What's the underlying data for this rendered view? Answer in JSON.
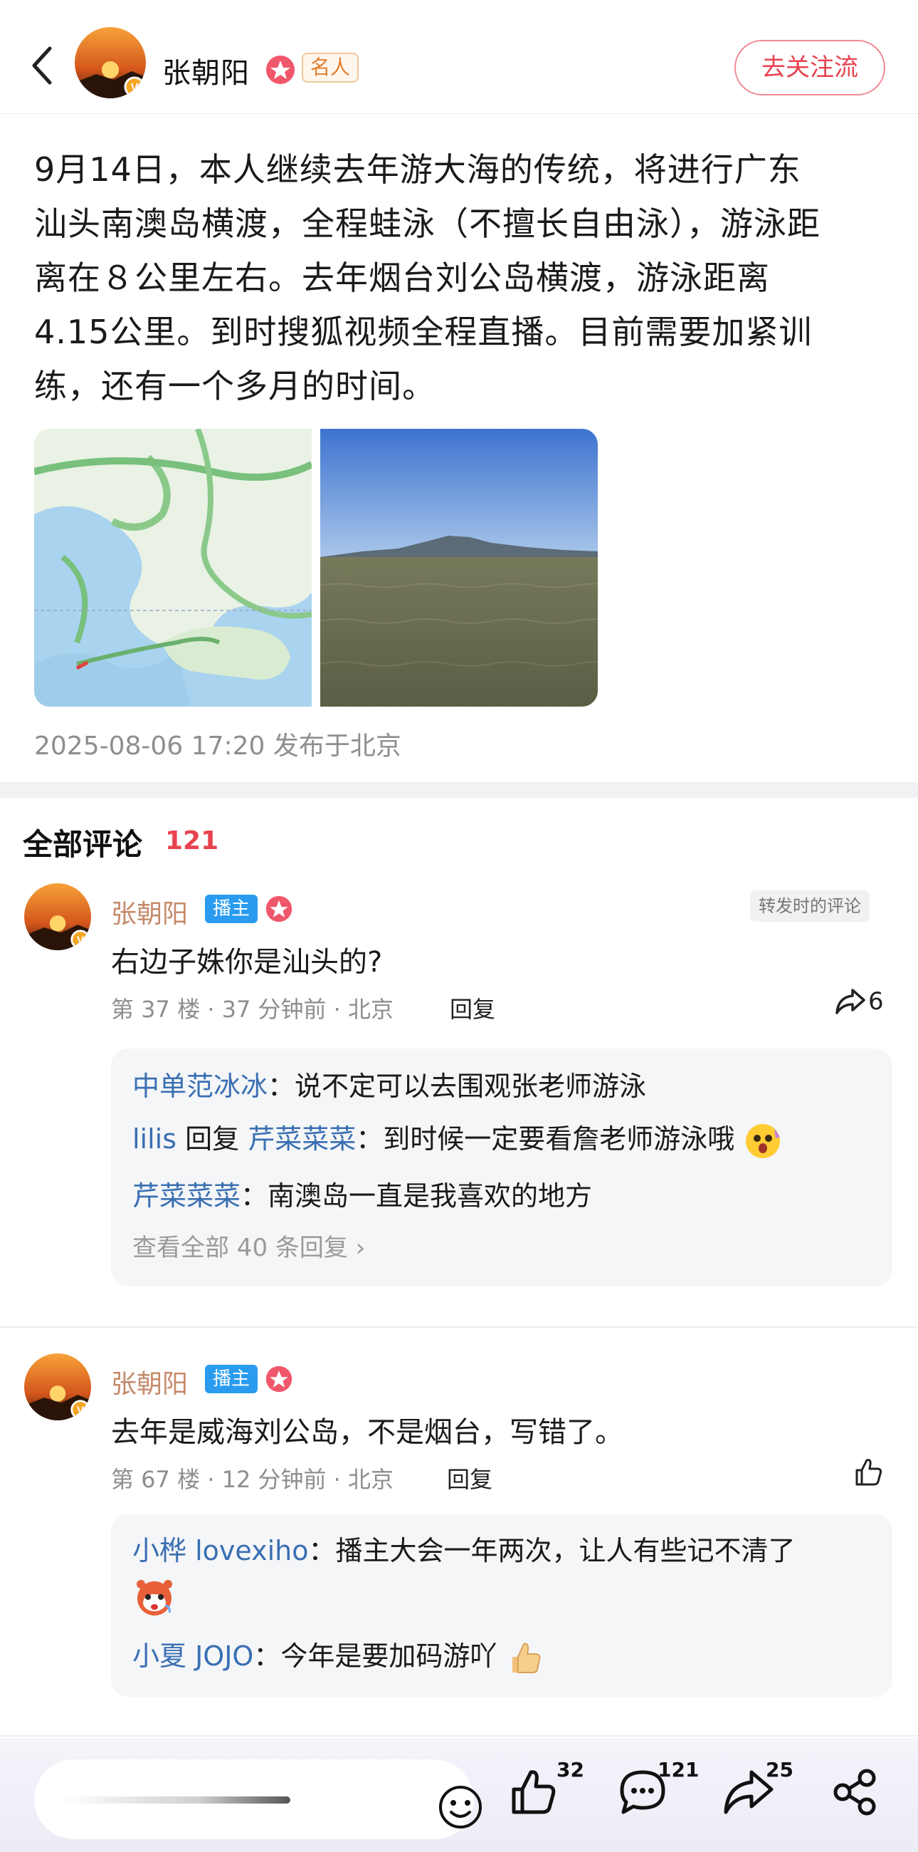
{
  "header": {
    "author_name": "张朝阳",
    "tag": "名人",
    "unfollow_label": "去关注流"
  },
  "post": {
    "lines": [
      "9月14日，本人继续去年游大海的传统，将进行广东",
      "汕头南澳岛横渡，全程蛙泳（不擅长自由泳），游泳距",
      "离在８公里左右。去年烟台刘公岛横渡，游泳距离",
      "4.15公里。到时搜狐视频全程直播。目前需要加紧训",
      "练，还有一个多月的时间。"
    ],
    "meta": "2025-08-06 17:20 发布于北京",
    "colors": {
      "map_bg": "#e8f1e3",
      "sea": "#6e7052",
      "sky": "#4a7ed6"
    }
  },
  "comments_header": {
    "title": "全部评论",
    "count": "121"
  },
  "comments": [
    {
      "name": "张朝阳",
      "badge": "播主",
      "repost_tag": "转发时的评论",
      "text": "右边子姝你是汕头的?",
      "meta": "第 37 楼 · 37 分钟前 · 北京",
      "reply_label": "回复",
      "share_count": "6",
      "replies": [
        {
          "name": "中单范冰冰",
          "sep": "：",
          "text": "说不定可以去围观张老师游泳"
        },
        {
          "name": "lilis",
          "mid": " 回复 ",
          "to": "芹菜菜菜",
          "sep": "：",
          "text": "到时候一定要看詹老师游泳哦"
        },
        {
          "name": "芹菜菜菜",
          "sep": "：",
          "text": "南澳岛一直是我喜欢的地方"
        }
      ],
      "more": "查看全部 40 条回复 ›"
    },
    {
      "name": "张朝阳",
      "badge": "播主",
      "text": "去年是威海刘公岛，不是烟台，写错了。",
      "meta": "第 67 楼 · 12 分钟前 · 北京",
      "reply_label": "回复",
      "replies": [
        {
          "name": "小桦 lovexiho",
          "sep": "：",
          "text": "播主大会一年两次，让人有些记不清了"
        },
        {
          "name": "小夏 JOJO",
          "sep": "：",
          "text": "今年是要加码游吖"
        }
      ]
    }
  ],
  "bottom_bar": {
    "like_count": "32",
    "comment_count": "121",
    "share_count": "25"
  }
}
